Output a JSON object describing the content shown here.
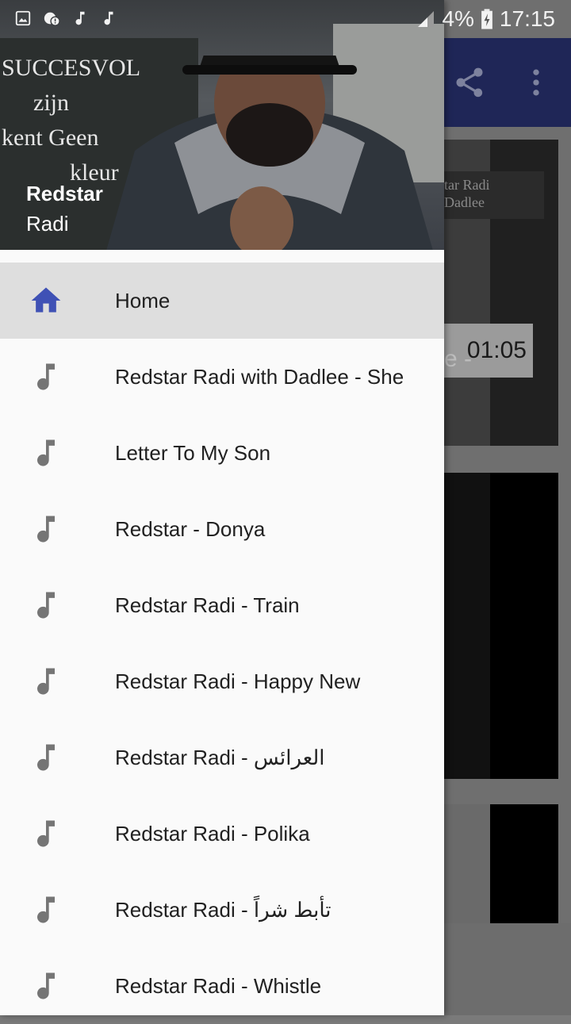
{
  "status_bar": {
    "left_icons": [
      "image-icon",
      "alert-icon",
      "music-note-icon",
      "music-note-icon"
    ],
    "battery_text": "4%",
    "time": "17:15"
  },
  "toolbar": {
    "icons": [
      "share-icon",
      "more-vert-icon"
    ]
  },
  "background_content": {
    "card1_sign": "tar Radi\nDadlee",
    "card1_time": "01:05",
    "card1_suffix": "e -"
  },
  "drawer": {
    "header": {
      "title": "Redstar",
      "subtitle": "Radi",
      "board_text": [
        "SUCCESVOL",
        "zijn",
        "kent Geen",
        "kleur"
      ]
    },
    "items": [
      {
        "label": "Home",
        "icon": "home-icon",
        "active": true
      },
      {
        "label": "Redstar Radi with Dadlee - She",
        "icon": "music-note-icon"
      },
      {
        "label": "Letter To My Son",
        "icon": "music-note-icon"
      },
      {
        "label": "Redstar - Donya",
        "icon": "music-note-icon"
      },
      {
        "label": "Redstar Radi - Train",
        "icon": "music-note-icon"
      },
      {
        "label": "Redstar Radi - Happy New",
        "icon": "music-note-icon"
      },
      {
        "label": "Redstar Radi - العرائس",
        "icon": "music-note-icon"
      },
      {
        "label": "Redstar Radi - Polika",
        "icon": "music-note-icon"
      },
      {
        "label": "Redstar Radi - تأبط شراً",
        "icon": "music-note-icon"
      },
      {
        "label": "Redstar Radi - Whistle",
        "icon": "music-note-icon"
      }
    ]
  },
  "colors": {
    "toolbar": "#1f2657",
    "accent_icon": "#3f51b5",
    "menu_icon": "#757575",
    "active_item_bg": "#dedede"
  }
}
